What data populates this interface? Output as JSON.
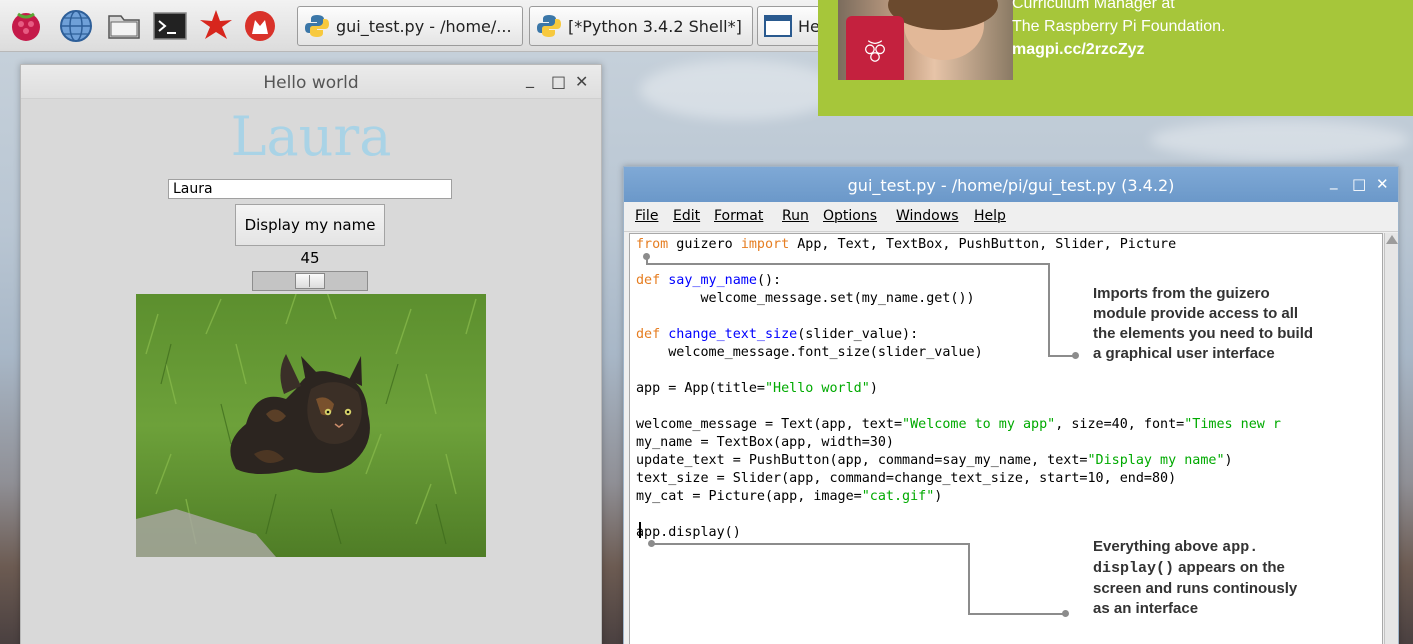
{
  "taskbar": {
    "launchers": [
      "raspberry-menu-icon",
      "web-browser-icon",
      "file-manager-icon",
      "terminal-icon",
      "mathematica-icon",
      "wolfram-icon"
    ],
    "tasks": [
      {
        "label": "gui_test.py - /home/...",
        "icon": "python-icon"
      },
      {
        "label": "[*Python 3.4.2 Shell*]",
        "icon": "python-icon"
      },
      {
        "label": "He",
        "icon": "window-icon"
      }
    ]
  },
  "author": {
    "line1": "Curriculum Manager at",
    "line2": "The Raspberry Pi Foundation.",
    "link": "magpi.cc/2rzcZyz"
  },
  "hello_window": {
    "title": "Hello world",
    "minimize": "_",
    "maximize": "□",
    "close": "✕",
    "welcome_text": "Laura",
    "name_value": "Laura",
    "button_label": "Display my name",
    "slider_value": "45",
    "slider_min": 10,
    "slider_max": 80
  },
  "idle_window": {
    "title": "gui_test.py - /home/pi/gui_test.py (3.4.2)",
    "minimize": "_",
    "maximize": "□",
    "close": "✕",
    "menu": [
      "File",
      "Edit",
      "Format",
      "Run",
      "Options",
      "Windows",
      "Help"
    ],
    "code_lines": [
      [
        {
          "t": "from",
          "c": "kw"
        },
        {
          "t": " guizero ",
          "c": ""
        },
        {
          "t": "import",
          "c": "kw"
        },
        {
          "t": " App, Text, TextBox, PushButton, Slider, Picture",
          "c": ""
        }
      ],
      [],
      [
        {
          "t": "def",
          "c": "kw"
        },
        {
          "t": " ",
          "c": ""
        },
        {
          "t": "say_my_name",
          "c": "def"
        },
        {
          "t": "():",
          "c": ""
        }
      ],
      [
        {
          "t": "        welcome_message.set(my_name.get())",
          "c": ""
        }
      ],
      [],
      [
        {
          "t": "def",
          "c": "kw"
        },
        {
          "t": " ",
          "c": ""
        },
        {
          "t": "change_text_size",
          "c": "def"
        },
        {
          "t": "(slider_value):",
          "c": ""
        }
      ],
      [
        {
          "t": "    welcome_message.font_size(slider_value)",
          "c": ""
        }
      ],
      [],
      [
        {
          "t": "app = App(title=",
          "c": ""
        },
        {
          "t": "\"Hello world\"",
          "c": "str"
        },
        {
          "t": ")",
          "c": ""
        }
      ],
      [],
      [
        {
          "t": "welcome_message = Text(app, text=",
          "c": ""
        },
        {
          "t": "\"Welcome to my app\"",
          "c": "str"
        },
        {
          "t": ", size=40, font=",
          "c": ""
        },
        {
          "t": "\"Times new r",
          "c": "str"
        }
      ],
      [
        {
          "t": "my_name = TextBox(app, width=30)",
          "c": ""
        }
      ],
      [
        {
          "t": "update_text = PushButton(app, command=say_my_name, text=",
          "c": ""
        },
        {
          "t": "\"Display my name\"",
          "c": "str"
        },
        {
          "t": ")",
          "c": ""
        }
      ],
      [
        {
          "t": "text_size = Slider(app, command=change_text_size, start=10, end=80)",
          "c": ""
        }
      ],
      [
        {
          "t": "my_cat = Picture(app, image=",
          "c": ""
        },
        {
          "t": "\"cat.gif\"",
          "c": "str"
        },
        {
          "t": ")",
          "c": ""
        }
      ],
      [],
      [
        {
          "t": "app.display()",
          "c": ""
        }
      ]
    ]
  },
  "callouts": {
    "imports": {
      "line1": "Imports from the guizero",
      "line2": "module provide access to all",
      "line3": "the elements you need to build",
      "line4": "a graphical user interface"
    },
    "display": {
      "line1a": "Everything above ",
      "line1b": "app.",
      "line2a": "display()",
      "line2b": " appears on the",
      "line3": "screen and runs continously",
      "line4": "as an interface"
    }
  }
}
